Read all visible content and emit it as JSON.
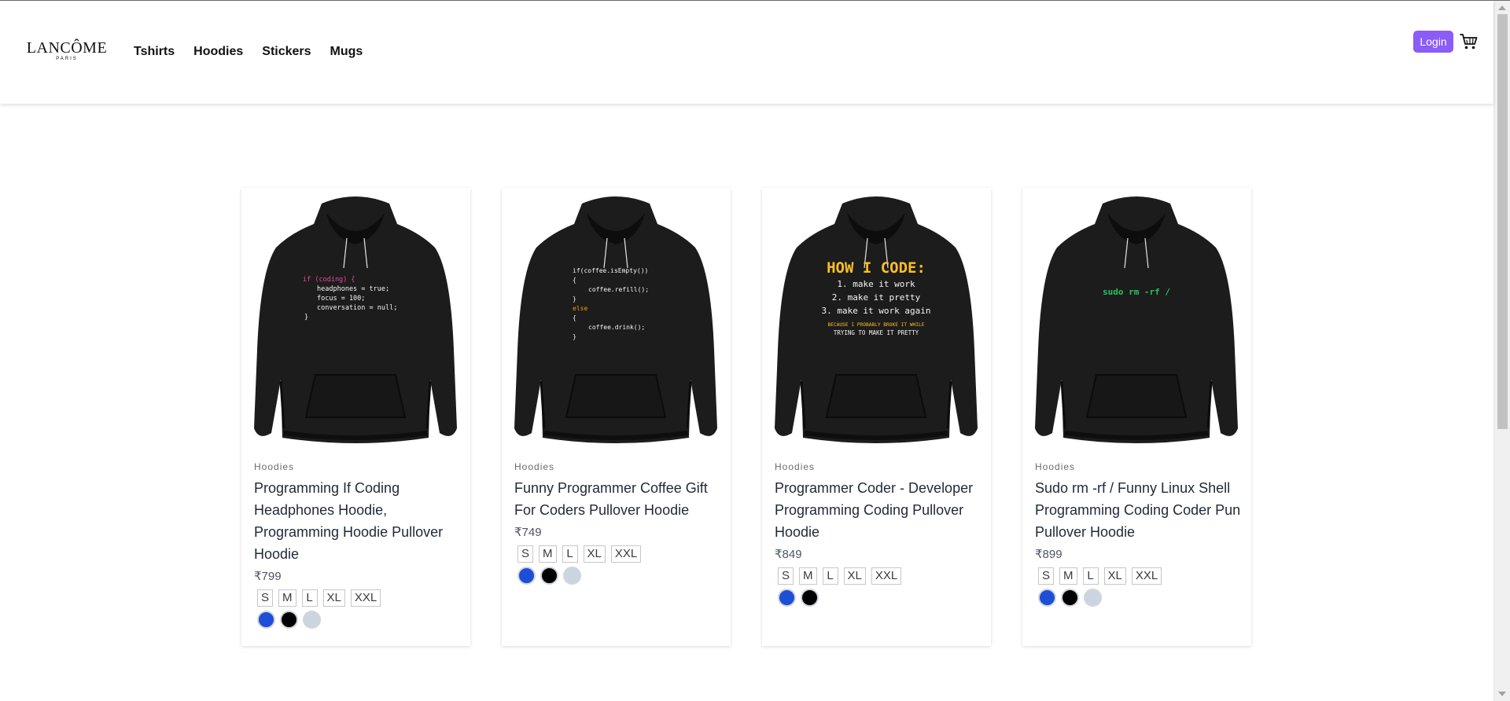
{
  "brand": {
    "name": "LANCÔME",
    "tagline": "PARIS"
  },
  "nav": {
    "links": [
      "Tshirts",
      "Hoodies",
      "Stickers",
      "Mugs"
    ]
  },
  "header": {
    "login_label": "Login"
  },
  "colors": {
    "accent": "#8b5cf6",
    "swatch_blue": "#1d4ed8",
    "swatch_black": "#000000",
    "swatch_gray": "#cbd5e1"
  },
  "products": [
    {
      "category": "Hoodies",
      "title": "Programming If Coding Headphones Hoodie, Programming Hoodie Pullover Hoodie",
      "price": "₹799",
      "sizes": [
        "S",
        "M",
        "L",
        "XL",
        "XXL"
      ],
      "colors": [
        "blue",
        "black",
        "gray"
      ],
      "print": [
        "if (coding) {",
        "headphones = true;",
        "focus = 100;",
        "conversation = null;",
        "}"
      ]
    },
    {
      "category": "Hoodies",
      "title": "Funny Programmer Coffee Gift For Coders Pullover Hoodie",
      "price": "₹749",
      "sizes": [
        "S",
        "M",
        "L",
        "XL",
        "XXL"
      ],
      "colors": [
        "blue",
        "black",
        "gray"
      ],
      "print": [
        "if(coffee.isEmpty())",
        "{",
        "coffee.refill();",
        "}",
        "else",
        "{",
        "coffee.drink();",
        "}"
      ]
    },
    {
      "category": "Hoodies",
      "title": "Programmer Coder - Developer Programming Coding Pullover Hoodie",
      "price": "₹849",
      "sizes": [
        "S",
        "M",
        "L",
        "XL",
        "XXL"
      ],
      "colors": [
        "blue",
        "black"
      ],
      "print": [
        "HOW I CODE:",
        "1. make it work",
        "2. make it pretty",
        "3. make it work again",
        "BECAUSE I PROBABLY BROKE IT WHILE",
        "TRYING TO MAKE IT PRETTY"
      ]
    },
    {
      "category": "Hoodies",
      "title": "Sudo rm -rf / Funny Linux Shell Programming Coding Coder Pun Pullover Hoodie",
      "price": "₹899",
      "sizes": [
        "S",
        "M",
        "L",
        "XL",
        "XXL"
      ],
      "colors": [
        "blue",
        "black",
        "gray"
      ],
      "print": [
        "sudo rm -rf /"
      ]
    }
  ]
}
